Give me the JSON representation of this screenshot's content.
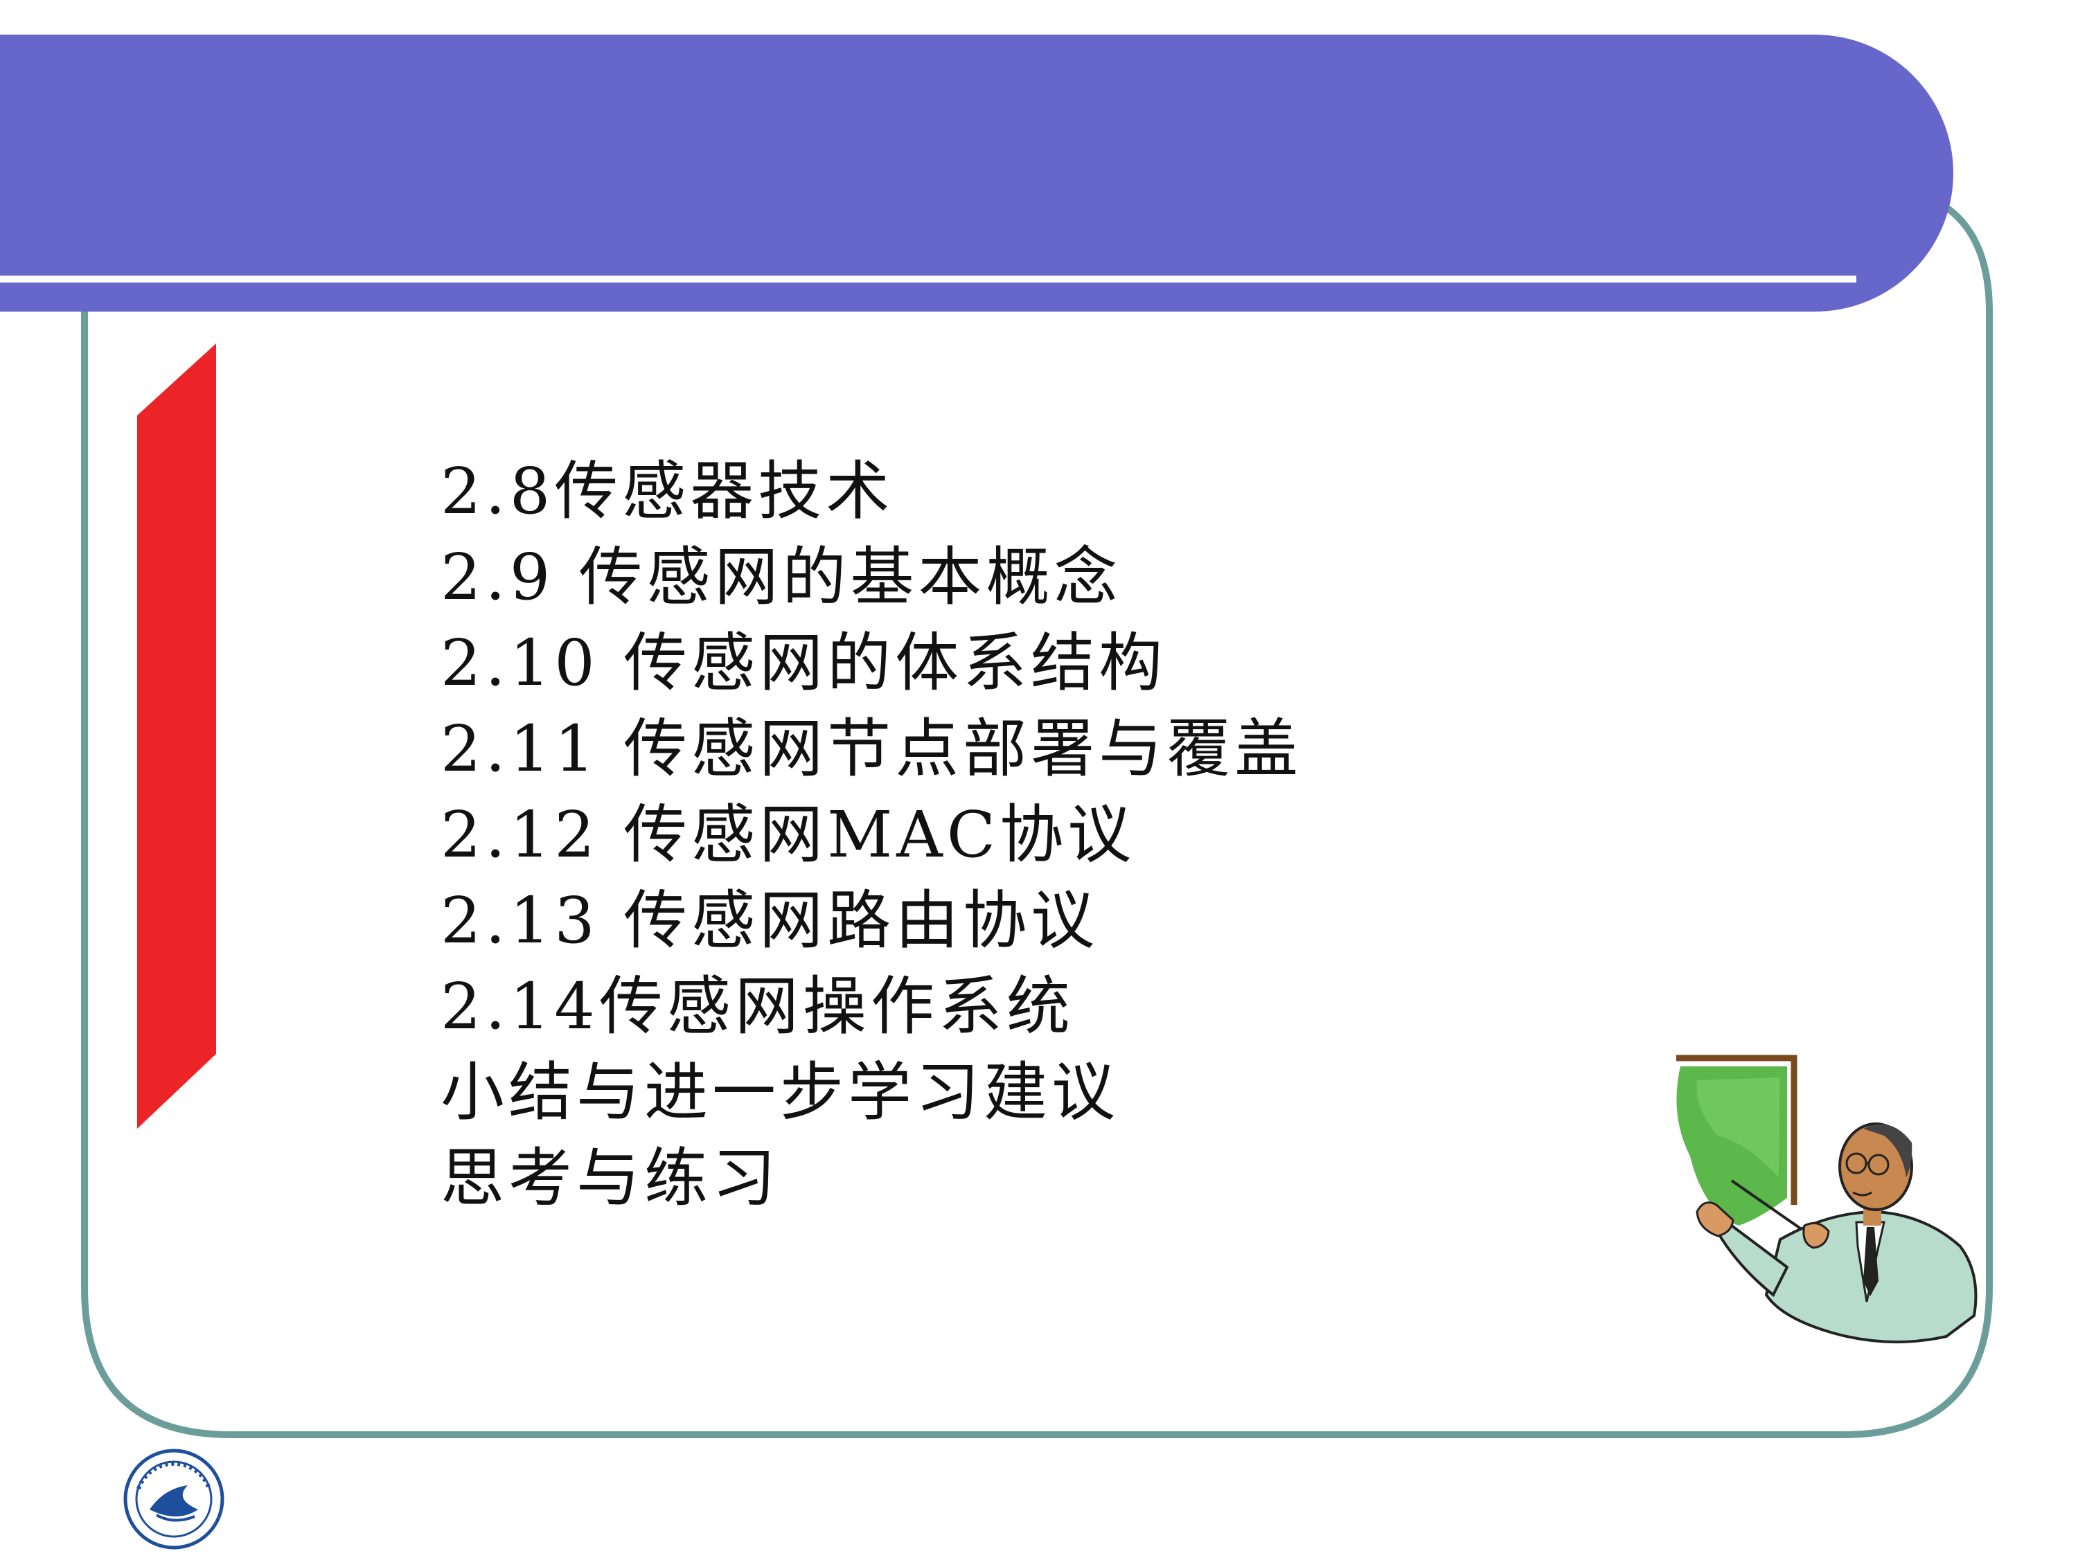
{
  "slide": {
    "toc_items": [
      "2.8传感器技术",
      "2.9 传感网的基本概念",
      "2.10 传感网的体系结构",
      "2.11 传感网节点部署与覆盖",
      "2.12 传感网MAC协议",
      "2.13 传感网路由协议",
      "2.14传感网操作系统",
      "小结与进一步学习建议",
      "思考与练习"
    ]
  },
  "colors": {
    "header_band": "#6767cb",
    "frame_border": "#6b9e9b",
    "accent_bar": "#ec2327",
    "text": "#111111"
  },
  "icons": {
    "teacher": "teacher-pointing-at-board-clipart",
    "logo": "university-seal-logo"
  }
}
